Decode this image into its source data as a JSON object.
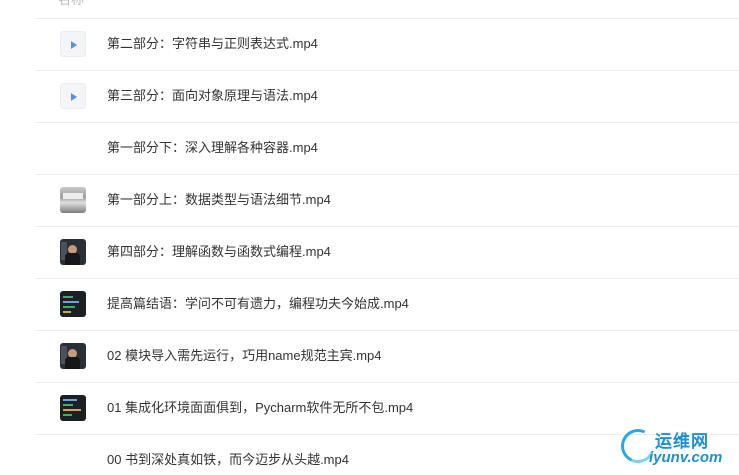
{
  "header": {
    "column_name": "名称"
  },
  "files": [
    {
      "name": "第二部分：字符串与正则表达式.mp4",
      "thumb": "video-icon"
    },
    {
      "name": "第三部分：面向对象原理与语法.mp4",
      "thumb": "video-icon"
    },
    {
      "name": "第一部分下：深入理解各种容器.mp4",
      "thumb": "blank"
    },
    {
      "name": "第一部分上：数据类型与语法细节.mp4",
      "thumb": "photo-grey"
    },
    {
      "name": "第四部分：理解函数与函数式编程.mp4",
      "thumb": "photo-dark"
    },
    {
      "name": "提高篇结语：学问不可有遗力，编程功夫今始成.mp4",
      "thumb": "photo-code"
    },
    {
      "name": "02 模块导入需先运行，巧用name规范主宾.mp4",
      "thumb": "photo-dark"
    },
    {
      "name": "01 集成化环境面面俱到，Pycharm软件无所不包.mp4",
      "thumb": "photo-code"
    },
    {
      "name": "00 书到深处真如铁，而今迈步从头越.mp4",
      "thumb": "blank"
    }
  ],
  "watermark": {
    "cn": "运维网",
    "en": "iyunv.com"
  },
  "colors": {
    "accent_play": "#5b8def",
    "watermark": "#1f8fd0",
    "divider": "#eeeeee",
    "text": "#333333"
  }
}
